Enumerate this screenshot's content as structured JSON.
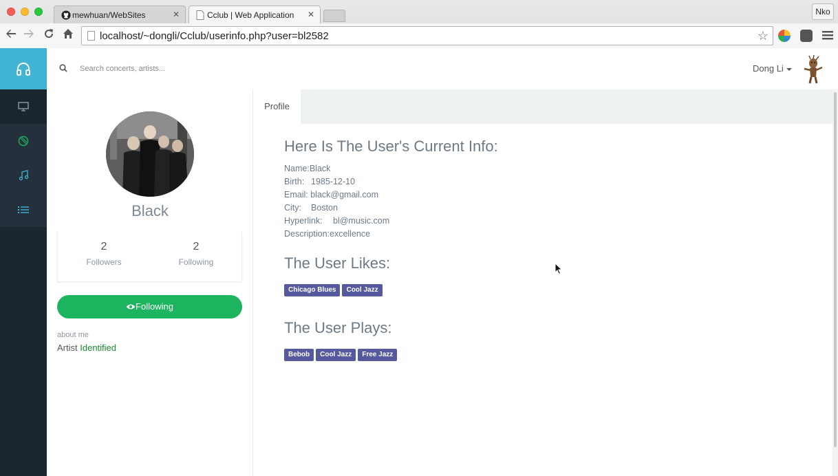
{
  "browser": {
    "tabs": [
      {
        "label": "mewhuan/WebSites",
        "icon": "github-icon"
      },
      {
        "label": "Cclub | Web Application",
        "icon": "page-icon"
      }
    ],
    "profile_button": "Nko",
    "url": "localhost/~dongli/Cclub/userinfo.php?user=bl2582"
  },
  "sidebar": {
    "items": [
      {
        "name": "headphones-icon",
        "color": "#ffffff"
      },
      {
        "name": "monitor-icon",
        "color": "#9aa4ad"
      },
      {
        "name": "compass-icon",
        "color": "#1cb45e"
      },
      {
        "name": "music-note-icon",
        "color": "#41b3d3"
      },
      {
        "name": "list-icon",
        "color": "#41b3d3"
      }
    ]
  },
  "header": {
    "search_placeholder": "Search concerts, artists...",
    "user_name": "Dong Li"
  },
  "profile": {
    "name": "Black",
    "followers_count": "2",
    "followers_label": "Followers",
    "following_count": "2",
    "following_label": "Following",
    "follow_button": "Following",
    "about_label": "about me",
    "about_text": "Artist",
    "about_highlight": "Identified"
  },
  "main": {
    "tab_label": "Profile",
    "info_heading": "Here Is The User's Current Info:",
    "info": [
      {
        "key": "Name:",
        "value": "Black"
      },
      {
        "key": "Birth:",
        "value": "1985-12-10"
      },
      {
        "key": "Email:",
        "value": "black@gmail.com"
      },
      {
        "key": "City:",
        "value": "Boston"
      },
      {
        "key": "Hyperlink:",
        "value": "bl@music.com"
      },
      {
        "key": "Description:",
        "value": "excellence"
      }
    ],
    "likes_heading": "The User Likes:",
    "likes": [
      "Chicago Blues",
      "Cool Jazz"
    ],
    "plays_heading": "The User Plays:",
    "plays": [
      "Bebob",
      "Cool Jazz",
      "Free Jazz"
    ]
  },
  "colors": {
    "accent": "#41b3d3",
    "follow_green": "#1cb45e",
    "tag": "#55599d",
    "sidebar_bg": "#1b252e"
  }
}
